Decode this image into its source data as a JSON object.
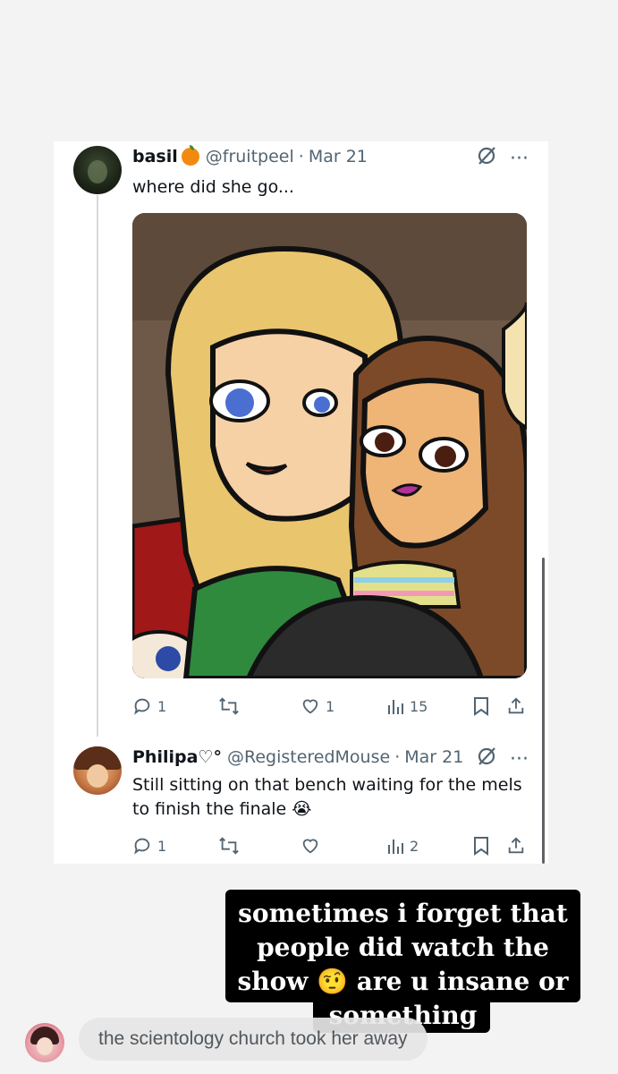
{
  "tweets": [
    {
      "name": "basil",
      "handle": "@fruitpeel",
      "sep": "·",
      "date": "Mar 21",
      "text": "where did she go...",
      "name_badge_icon": "orange-emoji",
      "actions": {
        "replies": "1",
        "reposts": "",
        "likes": "1",
        "views": "15"
      }
    },
    {
      "name": "Philipa",
      "name_suffix": "♡°",
      "handle": "@RegisteredMouse",
      "sep": "·",
      "date": "Mar 21",
      "text": "Still sitting on that bench waiting for the mels to finish the finale 😭",
      "actions": {
        "replies": "1",
        "reposts": "",
        "likes": "",
        "views": "2"
      }
    }
  ],
  "menu": {
    "more": "···",
    "grok_icon": "grok-icon"
  },
  "caption": {
    "line1": "sometimes i forget that",
    "line2": "people did watch the",
    "line3": "show 🤨 are u insane or",
    "line4": "something"
  },
  "reply": {
    "placeholder": "the scientology church took her away"
  },
  "colors": {
    "muted": "#536471",
    "text": "#0f1419",
    "caption_bg": "#000000",
    "badge": "#f28a12"
  }
}
